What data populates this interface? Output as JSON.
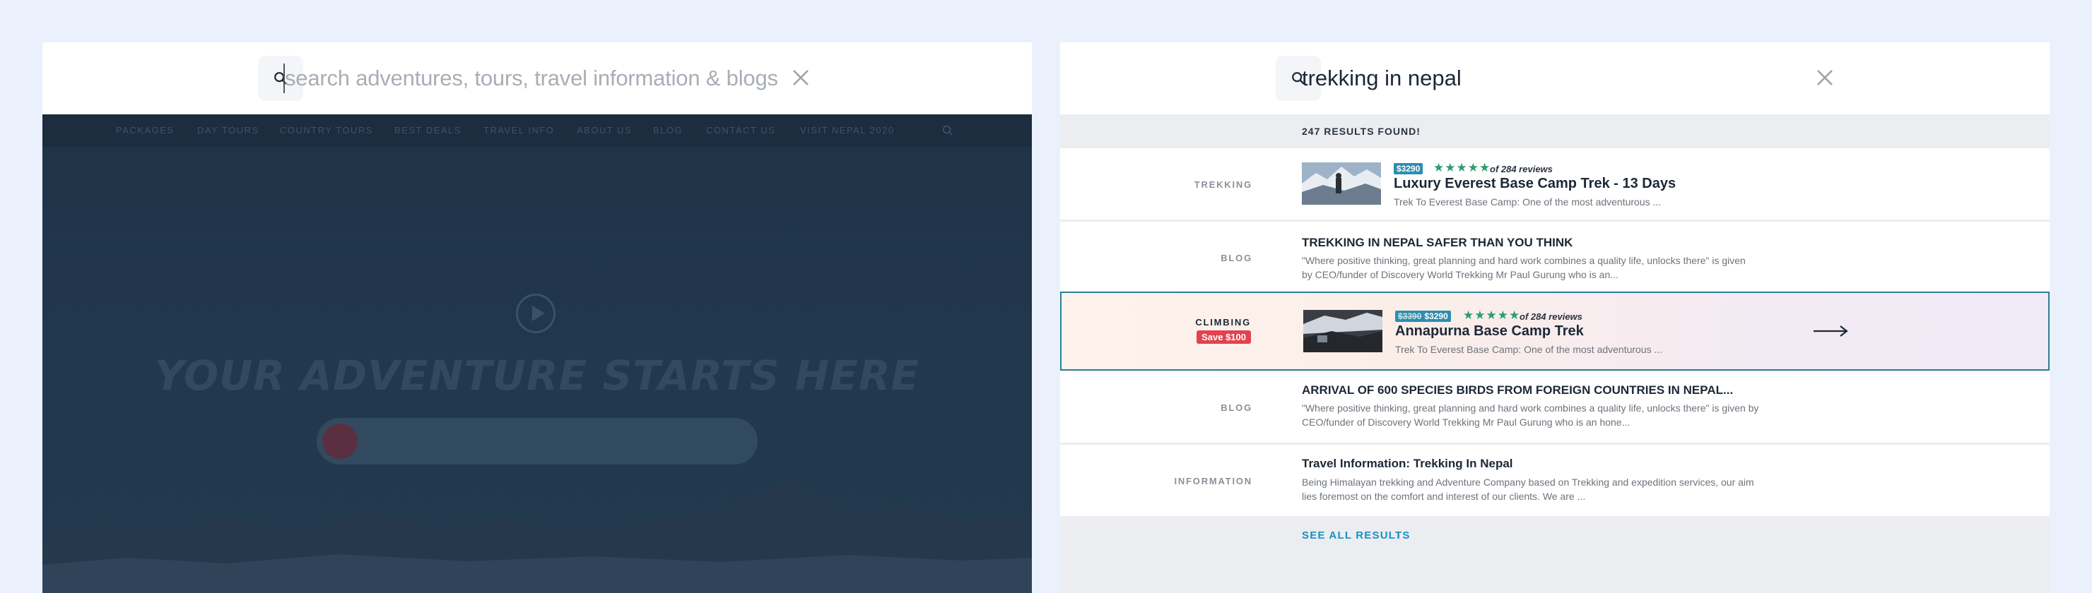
{
  "left_panel": {
    "search": {
      "placeholder": "search adventures, tours, travel information & blogs"
    },
    "nav": {
      "items": [
        "PACKAGES",
        "DAY TOURS",
        "COUNTRY TOURS",
        "BEST DEALS",
        "TRAVEL INFO",
        "ABOUT US",
        "BLOG",
        "CONTACT US",
        "VISIT NEPAL 2020"
      ]
    },
    "hero": {
      "title": "YOUR ADVENTURE STARTS HERE"
    }
  },
  "right_panel": {
    "search": {
      "query": "trekking in nepal"
    },
    "results_count": "247 RESULTS FOUND!",
    "results": [
      {
        "category": "TREKKING",
        "price": "$3290",
        "rating_stars": "★★★★★",
        "reviews": "of 284 reviews",
        "title": "Luxury Everest Base Camp Trek - 13 Days",
        "description": "Trek To Everest Base Camp: One of the most adventurous ..."
      },
      {
        "category": "BLOG",
        "title": "TREKKING IN NEPAL SAFER THAN YOU THINK",
        "description": "\"Where positive thinking, great planning and hard work combines a quality life, unlocks there\" is given by CEO/funder of Discovery World Trekking Mr Paul Gurung who is an..."
      },
      {
        "category": "CLIMBING",
        "badge": "Save $100",
        "old_price": "$3390",
        "price": "$3290",
        "rating_stars": "★★★★★",
        "reviews": "of 284 reviews",
        "title": "Annapurna Base Camp Trek",
        "description": "Trek To Everest Base Camp: One of the most adventurous ..."
      },
      {
        "category": "BLOG",
        "title": "ARRIVAL OF 600 SPECIES BIRDS FROM FOREIGN COUNTRIES IN NEPAL...",
        "description": "\"Where positive thinking, great planning and hard work combines a quality life, unlocks there\" is given by CEO/funder of Discovery World Trekking Mr Paul Gurung who is an hone..."
      },
      {
        "category": "INFORMATION",
        "title": "Travel Information: Trekking In Nepal",
        "description": "Being Himalayan trekking and Adventure Company based on Trekking and expedition services, our aim lies foremost on the comfort and interest of our clients. We are ..."
      }
    ],
    "see_all": "SEE ALL RESULTS",
    "see_all_chevron": "›"
  },
  "colors": {
    "accent": "#1a8fc4",
    "rating_green": "#2a9d6e",
    "price_badge": "#2e8eae",
    "save_badge": "#e2434f",
    "highlight_border": "#2d7f95"
  },
  "icons": {
    "search": "search-icon",
    "close": "close-icon",
    "arrow": "arrow-right-icon",
    "play": "play-icon"
  }
}
